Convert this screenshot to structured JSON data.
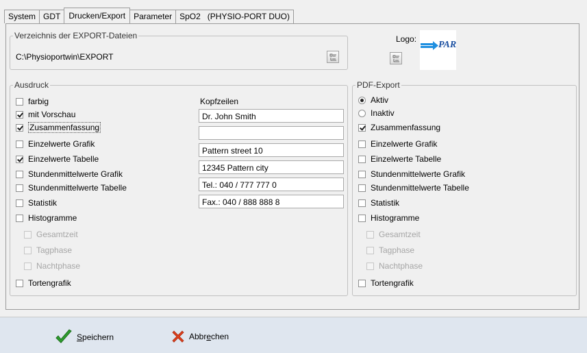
{
  "tabs": [
    {
      "label": "System",
      "active": false
    },
    {
      "label": "GDT",
      "active": false
    },
    {
      "label": "Drucken/Export",
      "active": true
    },
    {
      "label": "Parameter",
      "active": false
    },
    {
      "label": "SpO2",
      "active": false
    },
    {
      "label": "(PHYSIO-PORT DUO)",
      "active": false
    }
  ],
  "export_dir": {
    "title": "Verzeichnis der EXPORT-Dateien",
    "path": "C:\\Physioportwin\\EXPORT"
  },
  "logo": {
    "label": "Logo:",
    "image_text": "PAR",
    "accent": "#1f8fe0",
    "text_color": "#1b4fa0"
  },
  "ausdruck": {
    "title": "Ausdruck",
    "items": [
      {
        "label": "farbig",
        "checked": false,
        "disabled": false
      },
      {
        "label": "mit Vorschau",
        "checked": true,
        "disabled": false
      },
      {
        "label": "Zusammenfassung",
        "checked": true,
        "disabled": false
      },
      {
        "label": "Einzelwerte Grafik",
        "checked": false,
        "disabled": false
      },
      {
        "label": "Einzelwerte Tabelle",
        "checked": true,
        "disabled": false
      },
      {
        "label": "Stundenmittelwerte Grafik",
        "checked": false,
        "disabled": false
      },
      {
        "label": "Stundenmittelwerte Tabelle",
        "checked": false,
        "disabled": false
      },
      {
        "label": "Statistik",
        "checked": false,
        "disabled": false
      },
      {
        "label": "Histogramme",
        "checked": false,
        "disabled": false
      },
      {
        "label": "Gesamtzeit",
        "checked": false,
        "disabled": true
      },
      {
        "label": "Tagphase",
        "checked": false,
        "disabled": true
      },
      {
        "label": "Nachtphase",
        "checked": false,
        "disabled": true
      },
      {
        "label": "Tortengrafik",
        "checked": false,
        "disabled": false
      }
    ]
  },
  "kopfzeilen": {
    "label": "Kopfzeilen",
    "lines": [
      "Dr. John Smith",
      "",
      "Pattern street 10",
      "12345 Pattern city",
      "Tel.: 040 / 777 777 0",
      "Fax.: 040 / 888 888 8"
    ]
  },
  "pdf_export": {
    "title": "PDF-Export",
    "radios": [
      {
        "label": "Aktiv",
        "checked": true
      },
      {
        "label": "Inaktiv",
        "checked": false
      }
    ],
    "items": [
      {
        "label": "Zusammenfassung",
        "checked": true,
        "disabled": false
      },
      {
        "label": "Einzelwerte Grafik",
        "checked": false,
        "disabled": false
      },
      {
        "label": "Einzelwerte Tabelle",
        "checked": false,
        "disabled": false
      },
      {
        "label": "Stundenmittelwerte Grafik",
        "checked": false,
        "disabled": false
      },
      {
        "label": "Stundenmittelwerte Tabelle",
        "checked": false,
        "disabled": false
      },
      {
        "label": "Statistik",
        "checked": false,
        "disabled": false
      },
      {
        "label": "Histogramme",
        "checked": false,
        "disabled": false
      },
      {
        "label": "Gesamtzeit",
        "checked": false,
        "disabled": true
      },
      {
        "label": "Tagphase",
        "checked": false,
        "disabled": true
      },
      {
        "label": "Nachtphase",
        "checked": false,
        "disabled": true
      },
      {
        "label": "Tortengrafik",
        "checked": false,
        "disabled": false
      }
    ]
  },
  "buttons": {
    "save": {
      "prefix": "",
      "accel": "S",
      "rest": "peichern",
      "icon": "checkmark-icon",
      "color": "#2e9e2e"
    },
    "cancel": {
      "prefix": "Abbr",
      "accel": "e",
      "rest": "chen",
      "icon": "close-icon",
      "color": "#e0401c"
    }
  }
}
